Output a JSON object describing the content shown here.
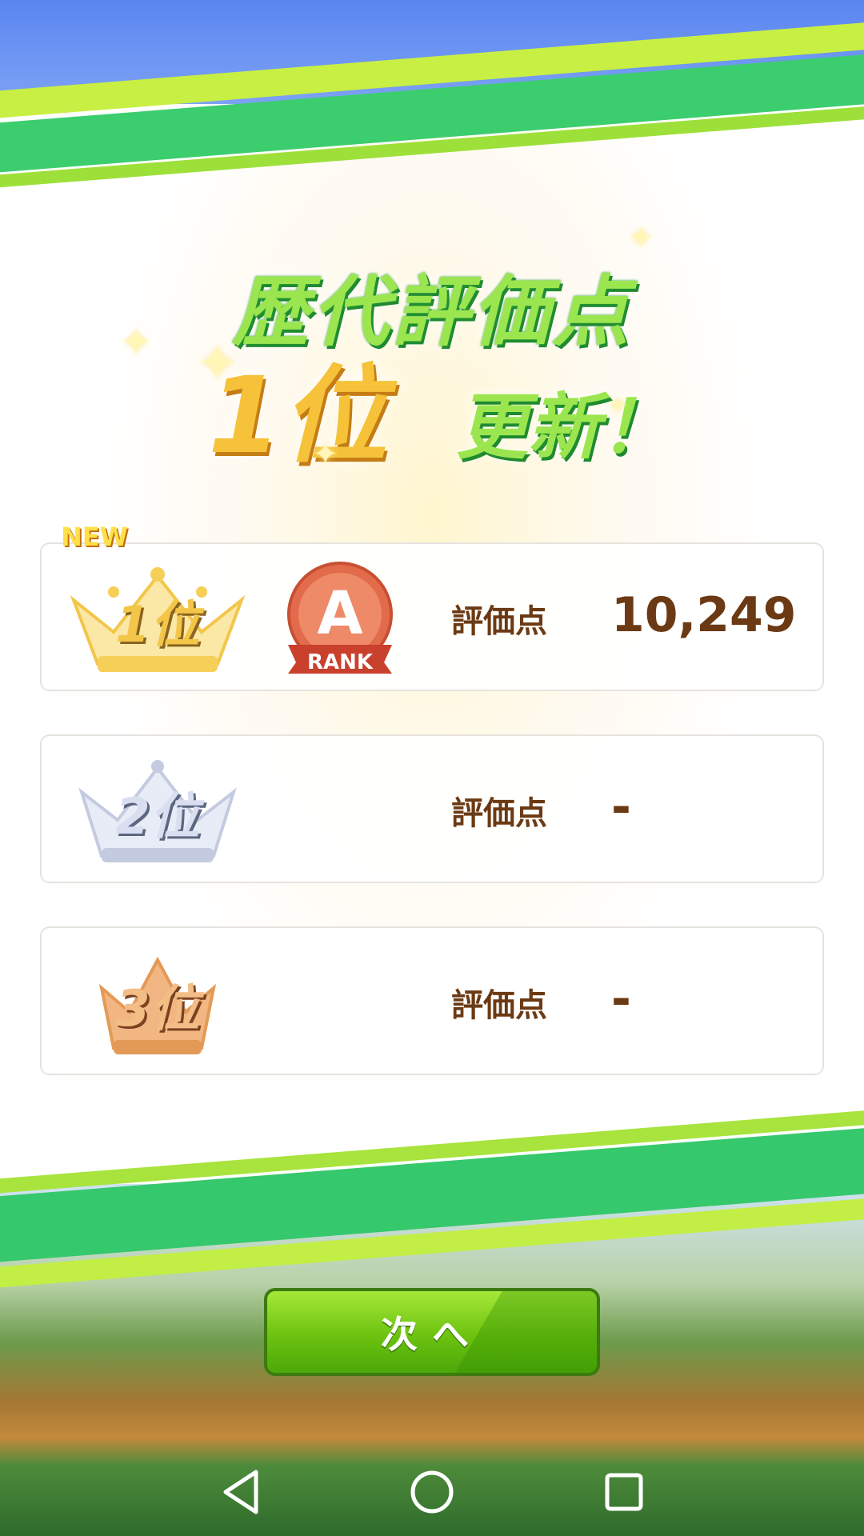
{
  "header": {
    "title": "歴代評価点",
    "rank": "1位",
    "update": "更新！"
  },
  "rankings": [
    {
      "rank_label": "1位",
      "new_tag": "NEW",
      "badge_letter": "A",
      "badge_text": "RANK",
      "score_label": "評価点",
      "score_value": "10,249"
    },
    {
      "rank_label": "2位",
      "score_label": "評価点",
      "score_value": "-"
    },
    {
      "rank_label": "3位",
      "score_label": "評価点",
      "score_value": "-"
    }
  ],
  "actions": {
    "next_label": "次へ"
  },
  "colors": {
    "gold": "#f6c23a",
    "silver": "#c4cbe0",
    "bronze": "#e39a57",
    "green": "#6cc20f",
    "score_text": "#6b3a14"
  },
  "navbar": {
    "icons": [
      "back-triangle-icon",
      "home-circle-icon",
      "recents-square-icon"
    ]
  }
}
